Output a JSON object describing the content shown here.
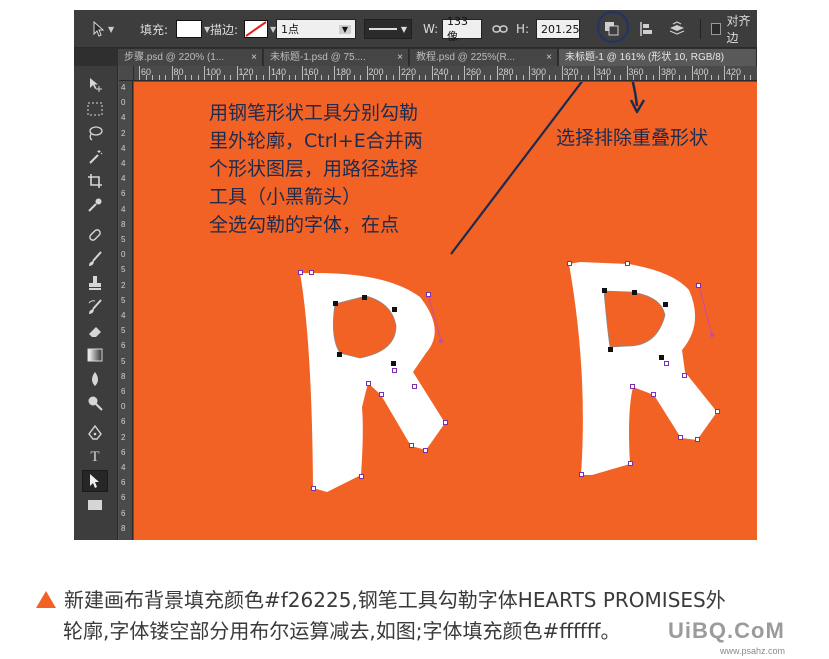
{
  "options_bar": {
    "fill_label": "填充:",
    "stroke_label": "描边:",
    "stroke_width": "1点",
    "w_label": "W:",
    "w_value": "133 像",
    "h_label": "H:",
    "h_value": "201.25",
    "align_label": "对齐边"
  },
  "tabs": [
    {
      "label": "步骤.psd @ 220% (1...",
      "close": "×"
    },
    {
      "label": "未标题-1.psd @ 75....",
      "close": "×"
    },
    {
      "label": "教程.psd @ 225%(R...",
      "close": "×"
    },
    {
      "label": "未标题-1 @ 161% (形状 10, RGB/8)",
      "close": ""
    }
  ],
  "ruler_h": [
    "60",
    "80",
    "100",
    "120",
    "140",
    "160",
    "180",
    "200",
    "220",
    "240",
    "260",
    "280",
    "300",
    "320",
    "340",
    "360",
    "380",
    "400",
    "420"
  ],
  "ruler_v": [
    "4",
    "0",
    "4",
    "2",
    "4",
    "4",
    "4",
    "6",
    "4",
    "8",
    "5",
    "0",
    "5",
    "2",
    "5",
    "4",
    "5",
    "6",
    "5",
    "8",
    "6",
    "0",
    "6",
    "2",
    "6",
    "4",
    "6",
    "6",
    "6",
    "8"
  ],
  "canvas": {
    "background": "#f26225",
    "note_left": [
      "用钢笔形状工具分别勾勒",
      "里外轮廓，Ctrl+E合并两",
      "个形状图层，用路径选择",
      "工具（小黑箭头）",
      "全选勾勒的字体，在点"
    ],
    "note_right": "选择排除重叠形状"
  },
  "caption": {
    "line1": "新建画布背景填充颜色#f26225,钢笔工具勾勒字体HEARTS PROMISES外",
    "line2": "轮廓,字体镂空部分用布尔运算减去,如图;字体填充颜色#ffffff。"
  },
  "watermark": {
    "brand": "UiBQ.CoM",
    "url": "www.psahz.com"
  },
  "colors": {
    "accent": "#f26225",
    "annotation": "#1d2b4e",
    "path_anchor": "#9b2fc8"
  }
}
